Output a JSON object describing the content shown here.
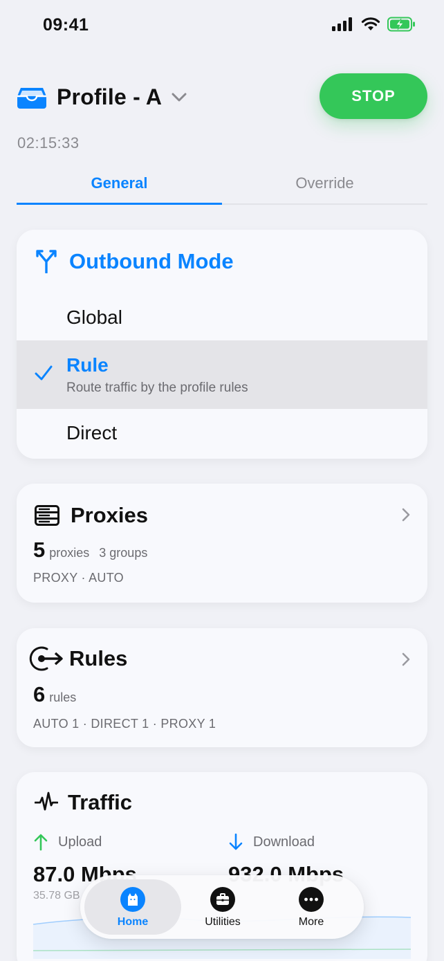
{
  "status_bar": {
    "time": "09:41"
  },
  "header": {
    "profile_name": "Profile - A",
    "stop_label": "STOP",
    "elapsed": "02:15:33"
  },
  "tabs": [
    {
      "label": "General",
      "active": true
    },
    {
      "label": "Override",
      "active": false
    }
  ],
  "outbound": {
    "title": "Outbound Mode",
    "modes": [
      {
        "label": "Global"
      },
      {
        "label": "Rule",
        "description": "Route traffic by the profile rules",
        "selected": true
      },
      {
        "label": "Direct"
      }
    ]
  },
  "proxies": {
    "title": "Proxies",
    "count": "5",
    "unit": "proxies",
    "groups": "3 groups",
    "summary": "PROXY · AUTO"
  },
  "rules": {
    "title": "Rules",
    "count": "6",
    "unit": "rules",
    "summary": "AUTO 1 · DIRECT 1 · PROXY 1"
  },
  "traffic": {
    "title": "Traffic",
    "upload": {
      "label": "Upload",
      "value": "87.0 Mbps",
      "total": "35.78 GB"
    },
    "download": {
      "label": "Download",
      "value": "932.0 Mbps"
    }
  },
  "nav": [
    {
      "label": "Home",
      "icon": "cat-icon",
      "active": true
    },
    {
      "label": "Utilities",
      "icon": "toolbox-icon",
      "active": false
    },
    {
      "label": "More",
      "icon": "more-dots-icon",
      "active": false
    }
  ],
  "colors": {
    "accent": "#0a84ff",
    "stop": "#34c759",
    "background": "#f0f1f6"
  }
}
